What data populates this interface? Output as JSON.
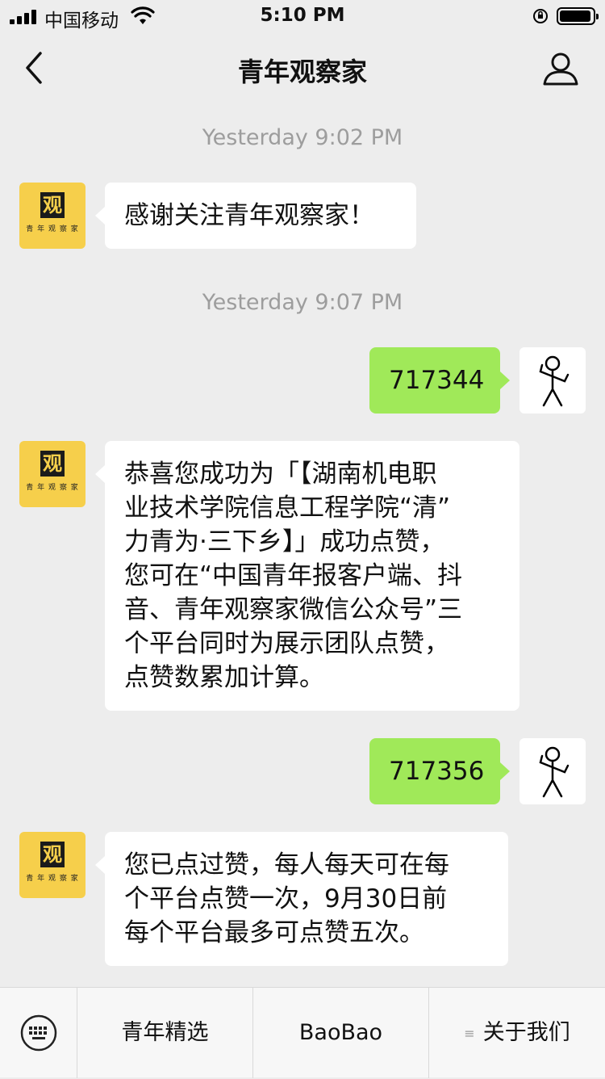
{
  "status_bar": {
    "carrier": "中国移动",
    "time": "5:10 PM",
    "icons": [
      "signal-icon",
      "wifi-icon",
      "orientation-lock-icon",
      "battery-icon"
    ]
  },
  "nav": {
    "title": "青年观察家",
    "back_icon": "chevron-left-icon",
    "profile_icon": "person-icon"
  },
  "brand_avatar": {
    "glyph": "观",
    "subtitle": "青 年 观 察 家"
  },
  "messages": [
    {
      "type": "timestamp",
      "text": "Yesterday 9:02 PM"
    },
    {
      "type": "incoming",
      "text": "感谢关注青年观察家！"
    },
    {
      "type": "timestamp",
      "text": "Yesterday 9:07 PM"
    },
    {
      "type": "outgoing",
      "text": "717344"
    },
    {
      "type": "incoming",
      "lines": [
        "恭喜您成功为「【湖南机电职",
        "业技术学院信息工程学院“清”",
        "力青为·三下乡】」成功点赞，",
        "您可在“中国青年报客户端、抖",
        "音、青年观察家微信公众号”三",
        "个平台同时为展示团队点赞，",
        "点赞数累加计算。"
      ]
    },
    {
      "type": "outgoing",
      "text": "717356"
    },
    {
      "type": "incoming",
      "lines": [
        "您已点过赞，每人每天可在每",
        "个平台点赞一次，9月30日前",
        "每个平台最多可点赞五次。"
      ]
    }
  ],
  "bottom_bar": {
    "keyboard_icon": "keyboard-icon",
    "menus": [
      "青年精选",
      "BaoBao",
      "关于我们"
    ],
    "menu_icon": "menu-lines-icon"
  }
}
